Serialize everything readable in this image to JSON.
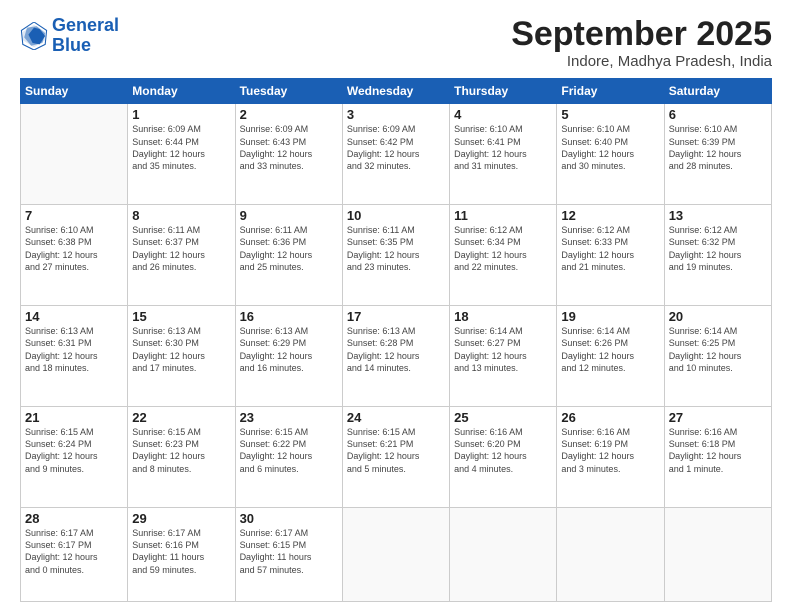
{
  "logo": {
    "line1": "General",
    "line2": "Blue"
  },
  "title": "September 2025",
  "location": "Indore, Madhya Pradesh, India",
  "days_header": [
    "Sunday",
    "Monday",
    "Tuesday",
    "Wednesday",
    "Thursday",
    "Friday",
    "Saturday"
  ],
  "weeks": [
    [
      {
        "day": "",
        "info": ""
      },
      {
        "day": "1",
        "info": "Sunrise: 6:09 AM\nSunset: 6:44 PM\nDaylight: 12 hours\nand 35 minutes."
      },
      {
        "day": "2",
        "info": "Sunrise: 6:09 AM\nSunset: 6:43 PM\nDaylight: 12 hours\nand 33 minutes."
      },
      {
        "day": "3",
        "info": "Sunrise: 6:09 AM\nSunset: 6:42 PM\nDaylight: 12 hours\nand 32 minutes."
      },
      {
        "day": "4",
        "info": "Sunrise: 6:10 AM\nSunset: 6:41 PM\nDaylight: 12 hours\nand 31 minutes."
      },
      {
        "day": "5",
        "info": "Sunrise: 6:10 AM\nSunset: 6:40 PM\nDaylight: 12 hours\nand 30 minutes."
      },
      {
        "day": "6",
        "info": "Sunrise: 6:10 AM\nSunset: 6:39 PM\nDaylight: 12 hours\nand 28 minutes."
      }
    ],
    [
      {
        "day": "7",
        "info": "Sunrise: 6:10 AM\nSunset: 6:38 PM\nDaylight: 12 hours\nand 27 minutes."
      },
      {
        "day": "8",
        "info": "Sunrise: 6:11 AM\nSunset: 6:37 PM\nDaylight: 12 hours\nand 26 minutes."
      },
      {
        "day": "9",
        "info": "Sunrise: 6:11 AM\nSunset: 6:36 PM\nDaylight: 12 hours\nand 25 minutes."
      },
      {
        "day": "10",
        "info": "Sunrise: 6:11 AM\nSunset: 6:35 PM\nDaylight: 12 hours\nand 23 minutes."
      },
      {
        "day": "11",
        "info": "Sunrise: 6:12 AM\nSunset: 6:34 PM\nDaylight: 12 hours\nand 22 minutes."
      },
      {
        "day": "12",
        "info": "Sunrise: 6:12 AM\nSunset: 6:33 PM\nDaylight: 12 hours\nand 21 minutes."
      },
      {
        "day": "13",
        "info": "Sunrise: 6:12 AM\nSunset: 6:32 PM\nDaylight: 12 hours\nand 19 minutes."
      }
    ],
    [
      {
        "day": "14",
        "info": "Sunrise: 6:13 AM\nSunset: 6:31 PM\nDaylight: 12 hours\nand 18 minutes."
      },
      {
        "day": "15",
        "info": "Sunrise: 6:13 AM\nSunset: 6:30 PM\nDaylight: 12 hours\nand 17 minutes."
      },
      {
        "day": "16",
        "info": "Sunrise: 6:13 AM\nSunset: 6:29 PM\nDaylight: 12 hours\nand 16 minutes."
      },
      {
        "day": "17",
        "info": "Sunrise: 6:13 AM\nSunset: 6:28 PM\nDaylight: 12 hours\nand 14 minutes."
      },
      {
        "day": "18",
        "info": "Sunrise: 6:14 AM\nSunset: 6:27 PM\nDaylight: 12 hours\nand 13 minutes."
      },
      {
        "day": "19",
        "info": "Sunrise: 6:14 AM\nSunset: 6:26 PM\nDaylight: 12 hours\nand 12 minutes."
      },
      {
        "day": "20",
        "info": "Sunrise: 6:14 AM\nSunset: 6:25 PM\nDaylight: 12 hours\nand 10 minutes."
      }
    ],
    [
      {
        "day": "21",
        "info": "Sunrise: 6:15 AM\nSunset: 6:24 PM\nDaylight: 12 hours\nand 9 minutes."
      },
      {
        "day": "22",
        "info": "Sunrise: 6:15 AM\nSunset: 6:23 PM\nDaylight: 12 hours\nand 8 minutes."
      },
      {
        "day": "23",
        "info": "Sunrise: 6:15 AM\nSunset: 6:22 PM\nDaylight: 12 hours\nand 6 minutes."
      },
      {
        "day": "24",
        "info": "Sunrise: 6:15 AM\nSunset: 6:21 PM\nDaylight: 12 hours\nand 5 minutes."
      },
      {
        "day": "25",
        "info": "Sunrise: 6:16 AM\nSunset: 6:20 PM\nDaylight: 12 hours\nand 4 minutes."
      },
      {
        "day": "26",
        "info": "Sunrise: 6:16 AM\nSunset: 6:19 PM\nDaylight: 12 hours\nand 3 minutes."
      },
      {
        "day": "27",
        "info": "Sunrise: 6:16 AM\nSunset: 6:18 PM\nDaylight: 12 hours\nand 1 minute."
      }
    ],
    [
      {
        "day": "28",
        "info": "Sunrise: 6:17 AM\nSunset: 6:17 PM\nDaylight: 12 hours\nand 0 minutes."
      },
      {
        "day": "29",
        "info": "Sunrise: 6:17 AM\nSunset: 6:16 PM\nDaylight: 11 hours\nand 59 minutes."
      },
      {
        "day": "30",
        "info": "Sunrise: 6:17 AM\nSunset: 6:15 PM\nDaylight: 11 hours\nand 57 minutes."
      },
      {
        "day": "",
        "info": ""
      },
      {
        "day": "",
        "info": ""
      },
      {
        "day": "",
        "info": ""
      },
      {
        "day": "",
        "info": ""
      }
    ]
  ]
}
